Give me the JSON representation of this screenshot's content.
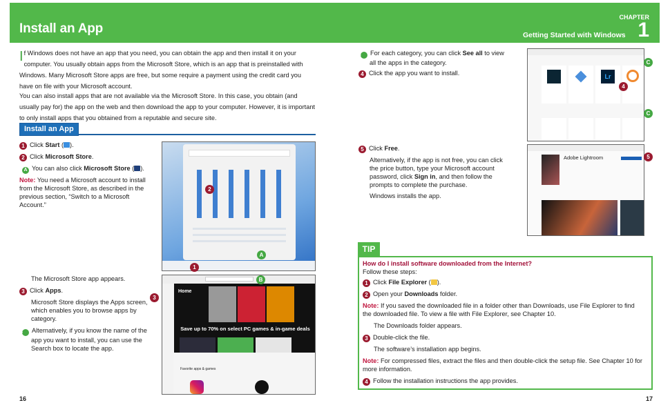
{
  "left": {
    "title": "Install an App",
    "intro1": "f Windows does not have an app that you need, you can obtain the app and then install it on your computer. You usually obtain apps from the Microsoft Store, which is an app that is preinstalled with Windows. Many Microsoft Store apps are free, but some require a payment using the credit card you have on file with your Microsoft account.",
    "dropcap": "I",
    "intro2": "You can also install apps that are not available via the Microsoft Store. In this case, you obtain (and usually pay for) the app on the web and then download the app to your computer. However, it is important to only install apps that you obtained from a reputable and secure site.",
    "section": "Install an App",
    "s1": {
      "n": "1",
      "a": "Click ",
      "b": "Start",
      "c": " (",
      "d": ")."
    },
    "s2": {
      "n": "2",
      "a": "Click ",
      "b": "Microsoft Store",
      "c": "."
    },
    "sA": {
      "n": "A",
      "a": "You can also click ",
      "b": "Microsoft Store",
      "c": " (",
      "d": ")."
    },
    "note": {
      "label": "Note:",
      "text": " You need a Microsoft account to install from the Microsoft Store, as described in the previous section, “Switch to a Microsoft Account.”"
    },
    "appears": "The Microsoft Store app appears.",
    "s3": {
      "n": "3",
      "a": "Click ",
      "b": "Apps",
      "c": "."
    },
    "s3desc": "Microsoft Store displays the Apps screen, which enables you to browse apps by category.",
    "sB": {
      "n": "B",
      "text": "Alternatively, if you know the name of the app you want to install, you can use the Search box to locate the app."
    },
    "page": "16",
    "shot2": {
      "home": "Home",
      "promo": "Save up to 70% on select PC games & in-game deals",
      "fav": "Favorite apps & games"
    }
  },
  "right": {
    "chapter_label": "CHAPTER",
    "chapter_num": "1",
    "chapter_title": "Getting Started with Windows",
    "sC": {
      "n": "C",
      "a": "For each category, you can click ",
      "b": "See all",
      "c": " to view all the apps in the category."
    },
    "s4": {
      "n": "4",
      "text": "Click the app you want to install."
    },
    "s5": {
      "n": "5",
      "a": "Click ",
      "b": "Free",
      "c": "."
    },
    "s5desc": {
      "a": "Alternatively, if the app is not free, you can click the price button, type your Microsoft account password, click ",
      "b": "Sign in",
      "c": ", and then follow the prompts to complete the purchase."
    },
    "installs": "Windows installs the app.",
    "shot4": {
      "app": "Adobe Lightroom",
      "lr": "Lr"
    },
    "page": "17",
    "tip": {
      "tab": "TIP",
      "question": "How do I install software downloaded from the Internet?",
      "follow": "Follow these steps:",
      "t1": {
        "n": "1",
        "a": "Click ",
        "b": "File Explorer",
        "c": " (",
        "d": ")."
      },
      "t2": {
        "n": "2",
        "a": "Open your ",
        "b": "Downloads",
        "c": " folder."
      },
      "note1": {
        "label": "Note:",
        "text": " If you saved the downloaded file in a folder other than Downloads, use File Explorer to find the downloaded file. To view a file with File Explorer, see Chapter 10."
      },
      "appears": "The Downloads folder appears.",
      "t3": {
        "n": "3",
        "text": "Double-click the file."
      },
      "begins": "The software’s installation app begins.",
      "note2": {
        "label": "Note:",
        "text": " For compressed files, extract the files and then double-click the setup file. See Chapter 10 for more information."
      },
      "t4": {
        "n": "4",
        "text": "Follow the installation instructions the app provides."
      }
    }
  },
  "colors": {
    "green": "#52b84a",
    "blue": "#1e6fb8",
    "step": "#9b1b30",
    "note": "#c0163f"
  }
}
